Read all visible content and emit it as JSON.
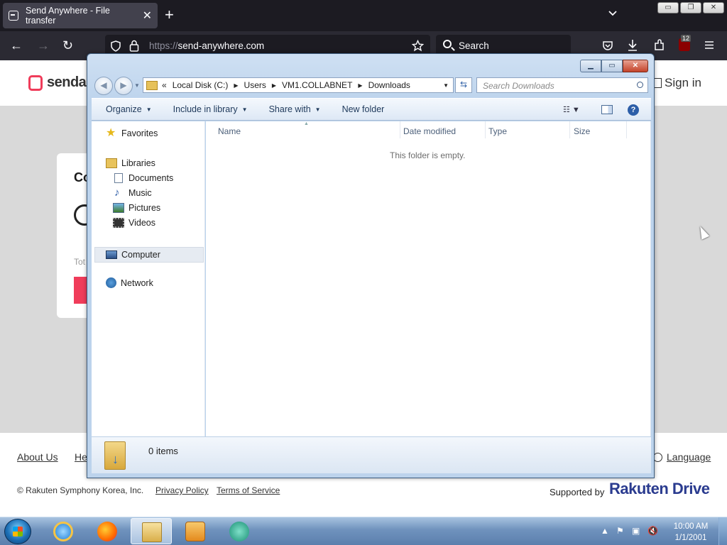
{
  "browser": {
    "tab_title": "Send Anywhere - File transfer",
    "tab_close": "✕",
    "new_tab": "+",
    "url_scheme": "https://",
    "url_host": "send-anywhere.com",
    "search_placeholder": "Search",
    "ext_badge": "12",
    "nav": {
      "back": "←",
      "forward": "→",
      "reload": "↻"
    },
    "toolbar_icons": [
      "pocket-icon",
      "download-icon",
      "extensions-icon",
      "ublock-icon",
      "menu-icon"
    ]
  },
  "webpage": {
    "logo_text": "sendan",
    "sign_in": "Sign in",
    "card_heading": "Co",
    "card_total": "Tot",
    "footer": {
      "about": "About Us",
      "help": "He",
      "language": "Language",
      "copyright": "© Rakuten Symphony Korea, Inc.",
      "privacy": "Privacy Policy",
      "terms": "Terms of Service",
      "supported_by": "Supported by",
      "brand": "Rakuten Drive"
    }
  },
  "explorer": {
    "breadcrumb": [
      "Local Disk (C:)",
      "Users",
      "VM1.COLLABNET",
      "Downloads"
    ],
    "breadcrumb_prefix": "«",
    "search_placeholder": "Search Downloads",
    "toolbar": {
      "organize": "Organize",
      "include_in_library": "Include in library",
      "share_with": "Share with",
      "new_folder": "New folder"
    },
    "nav_pane": {
      "favorites": "Favorites",
      "libraries": "Libraries",
      "documents": "Documents",
      "music": "Music",
      "pictures": "Pictures",
      "videos": "Videos",
      "computer": "Computer",
      "network": "Network"
    },
    "columns": [
      "Name",
      "Date modified",
      "Type",
      "Size"
    ],
    "empty_message": "This folder is empty.",
    "item_count": "0 items"
  },
  "taskbar": {
    "apps": [
      "internet-explorer",
      "firefox",
      "windows-explorer",
      "media-player",
      "other-app"
    ],
    "active_app": "windows-explorer",
    "time": "10:00 AM",
    "date": "1/1/2001"
  },
  "colors": {
    "brand_red": "#f03c5a",
    "rakuten_blue": "#2a3b8f",
    "firefox_dark": "#1c1b22",
    "aero_blue": "#bcd3ec"
  }
}
